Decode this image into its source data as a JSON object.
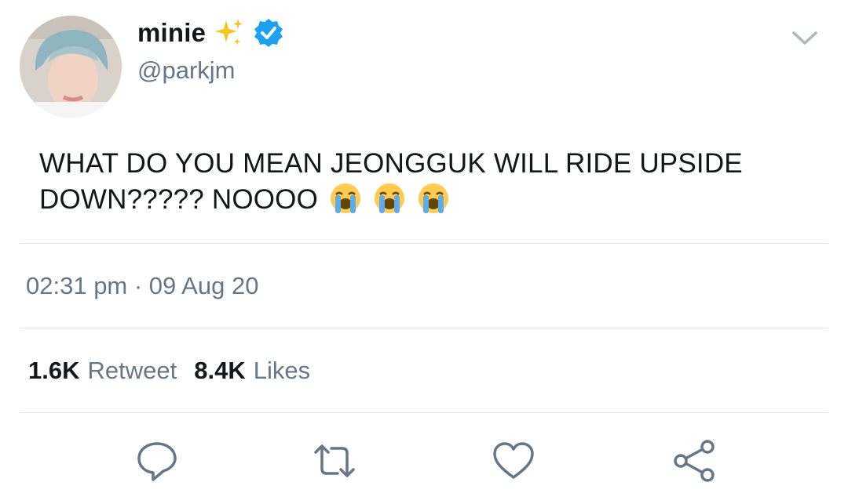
{
  "user": {
    "display_name": "minie",
    "handle": "@parkjm",
    "verified": true,
    "name_emoji": "sparkles-icon"
  },
  "tweet": {
    "text": "WHAT DO YOU MEAN JEONGGUK WILL RIDE UPSIDE DOWN????? NOOOO",
    "emojis": [
      "loudly-crying-face",
      "loudly-crying-face",
      "loudly-crying-face"
    ],
    "timestamp": "02:31 pm · 09 Aug 20"
  },
  "stats": {
    "retweet_count": "1.6K",
    "retweet_label": "Retweet",
    "like_count": "8.4K",
    "like_label": "Likes"
  },
  "actions": [
    "reply-icon",
    "retweet-icon",
    "like-icon",
    "share-icon"
  ],
  "colors": {
    "text": "#14171a",
    "secondary": "#657786",
    "verified_blue": "#1da1f2",
    "divider": "#e1e8ed"
  }
}
